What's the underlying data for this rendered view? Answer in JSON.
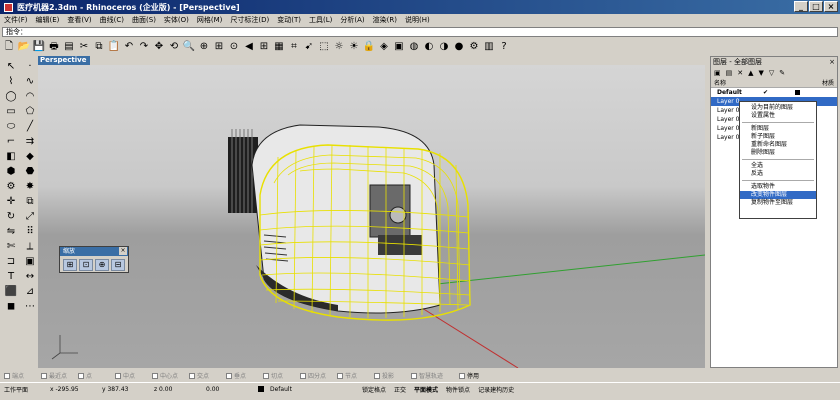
{
  "window": {
    "title": "医疗机器2.3dm - Rhinoceros (企业版) - [Perspective]"
  },
  "menu": {
    "items": [
      "文件(F)",
      "编辑(E)",
      "查看(V)",
      "曲线(C)",
      "曲面(S)",
      "实体(O)",
      "网格(M)",
      "尺寸标注(D)",
      "变动(T)",
      "工具(L)",
      "分析(A)",
      "渲染(R)",
      "说明(H)"
    ]
  },
  "command": {
    "label": "指令："
  },
  "viewport": {
    "name": "Perspective"
  },
  "zoom_panel": {
    "title": "缩放"
  },
  "layer_panel": {
    "title": "图层 - 全部图层",
    "col_name": "名称",
    "col_material": "材质",
    "layers": [
      {
        "name": "Default"
      },
      {
        "name": "Layer 0"
      },
      {
        "name": "Layer 0"
      },
      {
        "name": "Layer 0"
      },
      {
        "name": "Layer 0"
      },
      {
        "name": "Layer 0"
      }
    ]
  },
  "context_menu": {
    "items": [
      "设为目前的图层",
      "设置属性",
      "新图层",
      "新子图层",
      "重新命名图层",
      "删除图层",
      "全选",
      "反选",
      "选取物件",
      "改变物件图层",
      "复制物件至图层"
    ]
  },
  "osnap": {
    "items": [
      "端点",
      "最近点",
      "点",
      "中点",
      "中心点",
      "交点",
      "垂点",
      "切点",
      "四分点",
      "节点",
      "投影",
      "智慧轨迹"
    ],
    "disable": "停用"
  },
  "status": {
    "cplane": "工作平面",
    "x": "x -295.95",
    "y": "y 387.43",
    "z": "z 0.00",
    "value": "0.00",
    "layer": "Default",
    "grid_snap": "锁定格点",
    "ortho": "正交",
    "planar": "平面模式",
    "osnap": "物件锁点",
    "history": "记录建构历史"
  },
  "colors": {
    "title_bar": "#0a246a",
    "selected": "#316ac5",
    "wireframe": "#e8e000",
    "x_axis": "#c03030",
    "y_axis": "#30a030"
  }
}
